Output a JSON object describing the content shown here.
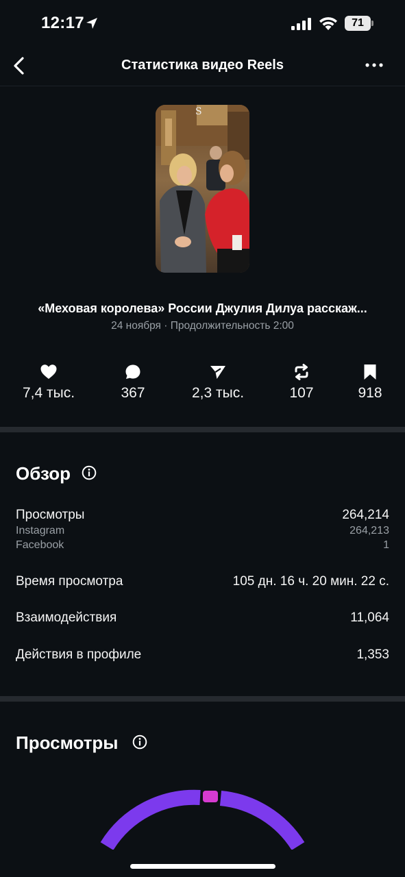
{
  "status_bar": {
    "time": "12:17",
    "battery": "71"
  },
  "nav": {
    "title": "Статистика видео Reels"
  },
  "video": {
    "title": "«Меховая королева» России Джулия Дилуа расскаж...",
    "meta": "24 ноября · Продолжительность 2:00"
  },
  "metrics": [
    {
      "icon": "heart-icon",
      "value": "7,4 тыс."
    },
    {
      "icon": "comment-icon",
      "value": "367"
    },
    {
      "icon": "share-icon",
      "value": "2,3 тыс."
    },
    {
      "icon": "repost-icon",
      "value": "107"
    },
    {
      "icon": "bookmark-icon",
      "value": "918"
    }
  ],
  "overview": {
    "title": "Обзор",
    "views_label": "Просмотры",
    "views_value": "264,214",
    "instagram_label": "Instagram",
    "instagram_value": "264,213",
    "facebook_label": "Facebook",
    "facebook_value": "1",
    "watch_time_label": "Время просмотра",
    "watch_time_value": "105 дн. 16 ч. 20 мин. 22 с.",
    "interactions_label": "Взаимодействия",
    "interactions_value": "11,064",
    "profile_actions_label": "Действия в профиле",
    "profile_actions_value": "1,353"
  },
  "views_section": {
    "title": "Просмотры",
    "colors": {
      "primary": "#7c3aed",
      "secondary": "#d63bd0"
    }
  },
  "colors": {
    "background": "#0c1014",
    "divider": "#262a2f",
    "muted_text": "#9aa0a6"
  }
}
